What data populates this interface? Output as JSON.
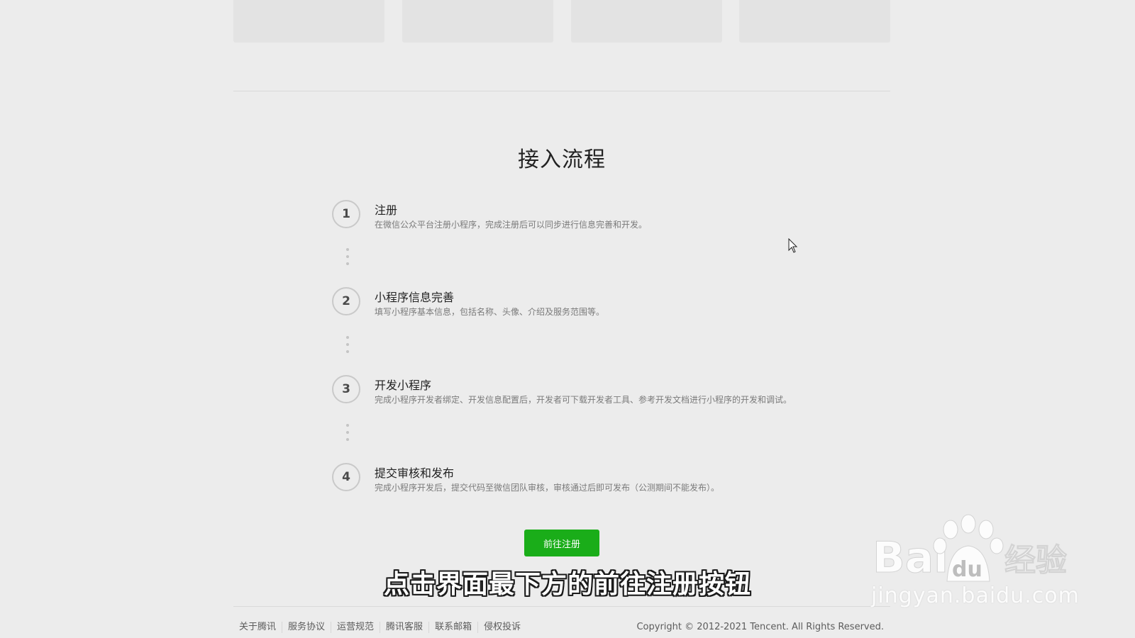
{
  "process": {
    "title": "接入流程",
    "steps": [
      {
        "number": "1",
        "title": "注册",
        "desc": "在微信公众平台注册小程序，完成注册后可以同步进行信息完善和开发。"
      },
      {
        "number": "2",
        "title": "小程序信息完善",
        "desc": "填写小程序基本信息，包括名称、头像、介绍及服务范围等。"
      },
      {
        "number": "3",
        "title": "开发小程序",
        "desc": "完成小程序开发者绑定、开发信息配置后，开发者可下载开发者工具、参考开发文档进行小程序的开发和调试。"
      },
      {
        "number": "4",
        "title": "提交审核和发布",
        "desc": "完成小程序开发后，提交代码至微信团队审核，审核通过后即可发布（公测期间不能发布）。"
      }
    ],
    "register_button": "前往注册"
  },
  "overlay": {
    "subtitle": "点击界面最下方的前往注册按钮",
    "watermark_logo": "Baidu经验",
    "watermark_url": "jingyan.baidu.com"
  },
  "footer": {
    "links": [
      "关于腾讯",
      "服务协议",
      "运营规范",
      "腾讯客服",
      "联系邮箱",
      "侵权投诉"
    ],
    "copyright": "Copyright © 2012-2021 Tencent. All Rights Reserved."
  },
  "colors": {
    "background": "#ececec",
    "accent_green": "#1aad19",
    "card_placeholder": "#e3e3e3"
  }
}
